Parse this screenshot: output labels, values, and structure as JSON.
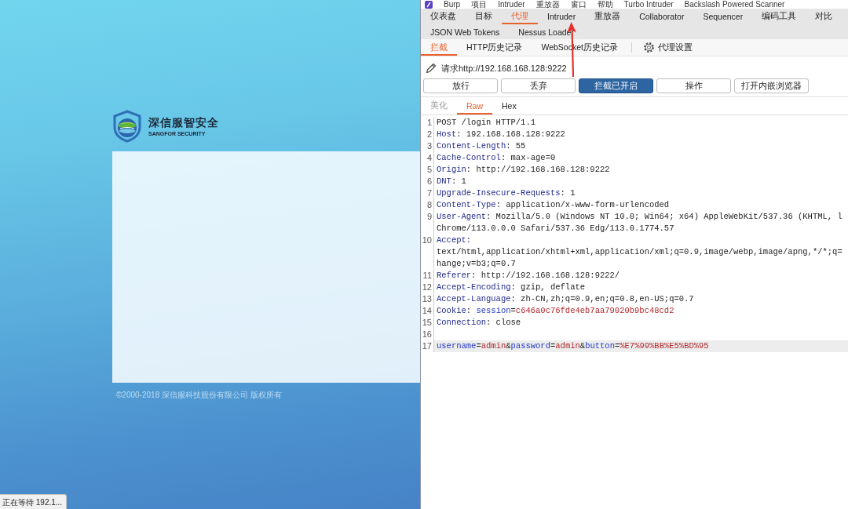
{
  "browser_page": {
    "logo": {
      "title": "深信服智安全",
      "subtitle": "SANGFOR SECURITY"
    },
    "copyright": "©2000-2018 深信服科技股份有限公司 版权所有",
    "status_bubble": "正在等待 192.1..."
  },
  "burp": {
    "menu": [
      "Burp",
      "项目",
      "Intruder",
      "重放器",
      "窗口",
      "帮助",
      "Turbo Intruder",
      "Backslash Powered Scanner"
    ],
    "tab_rows": [
      [
        {
          "label": "仪表盘",
          "selected": false
        },
        {
          "label": "目标",
          "selected": false
        },
        {
          "label": "代理",
          "selected": true
        },
        {
          "label": "Intruder",
          "selected": false
        },
        {
          "label": "重放器",
          "selected": false
        },
        {
          "label": "Collaborator",
          "selected": false
        },
        {
          "label": "Sequencer",
          "selected": false
        },
        {
          "label": "编码工具",
          "selected": false
        },
        {
          "label": "对比",
          "selected": false
        }
      ],
      [
        {
          "label": "JSON Web Tokens",
          "selected": false
        },
        {
          "label": "Nessus Loader",
          "selected": false
        }
      ]
    ],
    "proxy_tabs": [
      {
        "label": "拦截",
        "selected": true
      },
      {
        "label": "HTTP历史记录",
        "selected": false
      },
      {
        "label": "WebSocket历史记录",
        "selected": false
      }
    ],
    "proxy_settings": "代理设置",
    "request_target": "请求http://192.168.168.128:9222",
    "actions": [
      {
        "label": "放行",
        "on": false
      },
      {
        "label": "丢弃",
        "on": false
      },
      {
        "label": "拦截已开启",
        "on": true
      },
      {
        "label": "操作",
        "on": false
      },
      {
        "label": "打开内嵌浏览器",
        "on": false
      }
    ],
    "editor_tabs": [
      {
        "label": "美化",
        "selected": false,
        "disabled": true
      },
      {
        "label": "Raw",
        "selected": true,
        "disabled": false
      },
      {
        "label": "Hex",
        "selected": false,
        "disabled": false
      }
    ],
    "lines": [
      {
        "number": "1",
        "current": false,
        "rows": [
          [
            {
              "kind": "text",
              "text": "POST /login HTTP/1.1"
            }
          ]
        ]
      },
      {
        "number": "2",
        "current": false,
        "rows": [
          [
            {
              "kind": "header",
              "text": "Host"
            },
            {
              "kind": "text",
              "text": ": 192.168.168.128:9222"
            }
          ]
        ]
      },
      {
        "number": "3",
        "current": false,
        "rows": [
          [
            {
              "kind": "header",
              "text": "Content-Length"
            },
            {
              "kind": "text",
              "text": ": 55"
            }
          ]
        ]
      },
      {
        "number": "4",
        "current": false,
        "rows": [
          [
            {
              "kind": "header",
              "text": "Cache-Control"
            },
            {
              "kind": "text",
              "text": ": max-age=0"
            }
          ]
        ]
      },
      {
        "number": "5",
        "current": false,
        "rows": [
          [
            {
              "kind": "header",
              "text": "Origin"
            },
            {
              "kind": "text",
              "text": ": http://192.168.168.128:9222"
            }
          ]
        ]
      },
      {
        "number": "6",
        "current": false,
        "rows": [
          [
            {
              "kind": "header",
              "text": "DNT"
            },
            {
              "kind": "text",
              "text": ": 1"
            }
          ]
        ]
      },
      {
        "number": "7",
        "current": false,
        "rows": [
          [
            {
              "kind": "header",
              "text": "Upgrade-Insecure-Requests"
            },
            {
              "kind": "text",
              "text": ": 1"
            }
          ]
        ]
      },
      {
        "number": "8",
        "current": false,
        "rows": [
          [
            {
              "kind": "header",
              "text": "Content-Type"
            },
            {
              "kind": "text",
              "text": ": application/x-www-form-urlencoded"
            }
          ]
        ]
      },
      {
        "number": "9",
        "current": false,
        "rows": [
          [
            {
              "kind": "header",
              "text": "User-Agent"
            },
            {
              "kind": "text",
              "text": ": Mozilla/5.0 (Windows NT 10.0; Win64; x64) AppleWebKit/537.36 (KHTML, l"
            }
          ],
          [
            {
              "kind": "text",
              "text": "Chrome/113.0.0.0 Safari/537.36 Edg/113.0.1774.57"
            }
          ]
        ]
      },
      {
        "number": "10",
        "current": false,
        "rows": [
          [
            {
              "kind": "header",
              "text": "Accept"
            },
            {
              "kind": "text",
              "text": ":"
            }
          ],
          [
            {
              "kind": "text",
              "text": "text/html,application/xhtml+xml,application/xml;q=0.9,image/webp,image/apng,*/*;q="
            }
          ],
          [
            {
              "kind": "text",
              "text": "hange;v=b3;q=0.7"
            }
          ]
        ]
      },
      {
        "number": "11",
        "current": false,
        "rows": [
          [
            {
              "kind": "header",
              "text": "Referer"
            },
            {
              "kind": "text",
              "text": ": http://192.168.168.128:9222/"
            }
          ]
        ]
      },
      {
        "number": "12",
        "current": false,
        "rows": [
          [
            {
              "kind": "header",
              "text": "Accept-Encoding"
            },
            {
              "kind": "text",
              "text": ": gzip, deflate"
            }
          ]
        ]
      },
      {
        "number": "13",
        "current": false,
        "rows": [
          [
            {
              "kind": "header",
              "text": "Accept-Language"
            },
            {
              "kind": "text",
              "text": ": zh-CN,zh;q=0.9,en;q=0.8,en-US;q=0.7"
            }
          ]
        ]
      },
      {
        "number": "14",
        "current": false,
        "rows": [
          [
            {
              "kind": "header",
              "text": "Cookie"
            },
            {
              "kind": "text",
              "text": ": "
            },
            {
              "kind": "param-name",
              "text": "session"
            },
            {
              "kind": "text",
              "text": "="
            },
            {
              "kind": "param-value",
              "text": "c646a0c76fde4eb7aa79020b9bc48cd2"
            }
          ]
        ]
      },
      {
        "number": "15",
        "current": false,
        "rows": [
          [
            {
              "kind": "header",
              "text": "Connection"
            },
            {
              "kind": "text",
              "text": ": close"
            }
          ]
        ]
      },
      {
        "number": "16",
        "current": false
      },
      {
        "number": "17",
        "current": true,
        "rows": [
          [
            {
              "kind": "param-name",
              "text": "username"
            },
            {
              "kind": "text",
              "text": "="
            },
            {
              "kind": "param-value",
              "text": "admin"
            },
            {
              "kind": "text",
              "text": "&"
            },
            {
              "kind": "param-name",
              "text": "password"
            },
            {
              "kind": "text",
              "text": "="
            },
            {
              "kind": "param-value",
              "text": "admin"
            },
            {
              "kind": "text",
              "text": "&"
            },
            {
              "kind": "param-name",
              "text": "button"
            },
            {
              "kind": "text",
              "text": "="
            },
            {
              "kind": "param-value",
              "text": "%E7%99%BB%E5%BD%95"
            }
          ]
        ]
      }
    ]
  }
}
